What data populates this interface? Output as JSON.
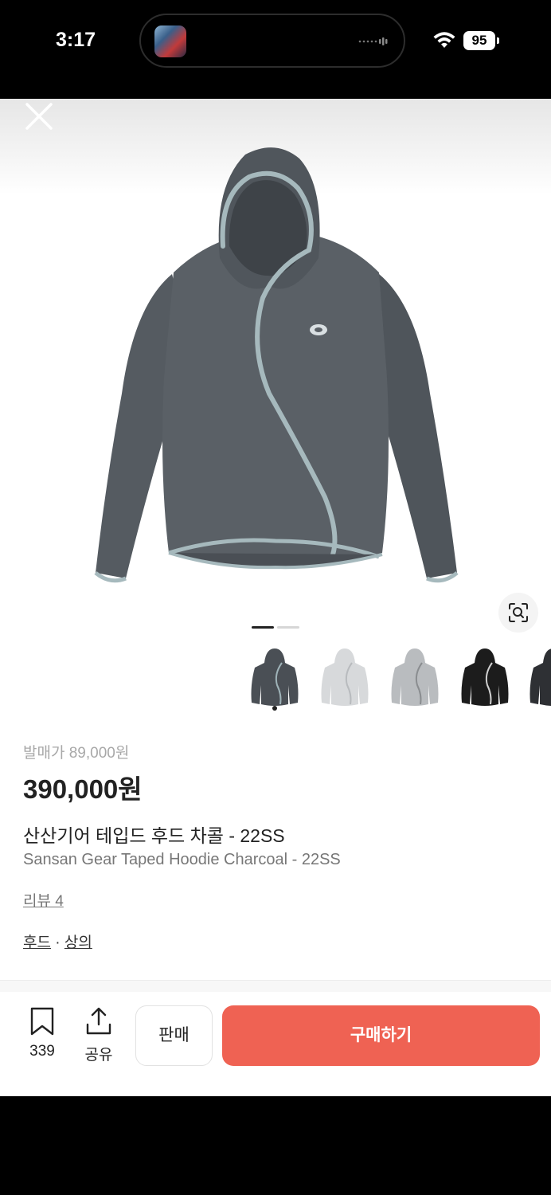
{
  "status_bar": {
    "time": "3:17",
    "battery": "95",
    "wifi_icon": "wifi-icon"
  },
  "header": {
    "close_icon": "close-icon"
  },
  "gallery": {
    "lens_icon": "visual-search-icon",
    "page_count": 2,
    "current_page": 1
  },
  "thumbnails": {
    "items": [
      {
        "color": "#4a4f55",
        "trim": "#9fb3b8"
      },
      {
        "color": "#d7d9db",
        "trim": "#b8bbbe"
      },
      {
        "color": "#b9bcbf",
        "trim": "#8a8d90"
      },
      {
        "color": "#1c1c1c",
        "trim": "#cfcfcf"
      },
      {
        "color": "#2e3034",
        "trim": "#7a7a7a"
      }
    ],
    "selected_index": 0
  },
  "product": {
    "release_price": "발매가 89,000원",
    "price": "390,000원",
    "name_ko": "산산기어 테입드 후드 차콜 - 22SS",
    "name_en": "Sansan Gear Taped Hoodie Charcoal - 22SS",
    "review": "리뷰 4",
    "category_1": "후드",
    "category_sep": " · ",
    "category_2": "상의"
  },
  "actions": {
    "bookmark_count": "339",
    "share_label": "공유",
    "sell_label": "판매",
    "buy_label": "구매하기"
  },
  "colors": {
    "accent": "#ef6253",
    "hoodie_body": "#555b61",
    "hoodie_trim": "#a6b9bd"
  }
}
